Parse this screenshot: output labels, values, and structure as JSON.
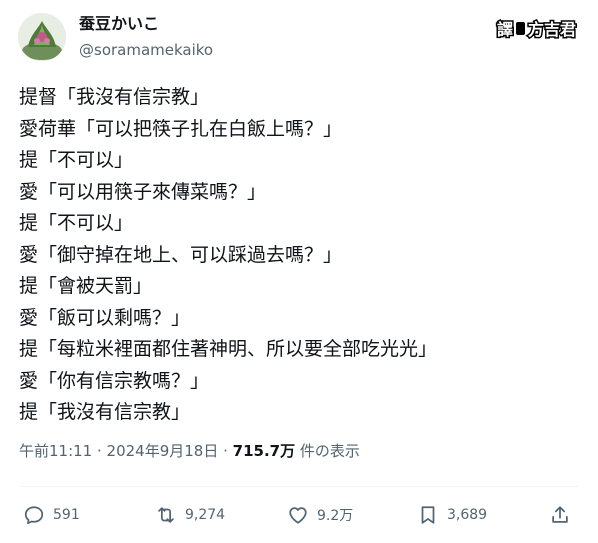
{
  "author": {
    "display_name": "蚕豆かいこ",
    "handle": "@soramamekaiko"
  },
  "watermark": {
    "part1": "譯",
    "part2": "方吉君"
  },
  "tweet": {
    "lines": [
      "提督「我沒有信宗教」",
      "愛荷華「可以把筷子扎在白飯上嗎？」",
      "提「不可以」",
      "愛「可以用筷子來傳菜嗎？」",
      "提「不可以」",
      "愛「御守掉在地上、可以踩過去嗎？」",
      "提「會被天罰」",
      "愛「飯可以剩嗎？」",
      "提「每粒米裡面都住著神明、所以要全部吃光光」",
      "愛「你有信宗教嗎？」",
      "提「我沒有信宗教」"
    ],
    "time": "午前11:11",
    "separator1": " · ",
    "date": "2024年9月18日",
    "separator2": " · ",
    "views": "715.7万",
    "views_label": " 件の表示"
  },
  "actions": {
    "reply": {
      "icon": "reply-icon",
      "count": "591"
    },
    "retweet": {
      "icon": "retweet-icon",
      "count": "9,274"
    },
    "like": {
      "icon": "heart-icon",
      "count": "9.2万"
    },
    "bookmark": {
      "icon": "bookmark-icon",
      "count": "3,689"
    },
    "share": {
      "icon": "share-icon"
    }
  }
}
